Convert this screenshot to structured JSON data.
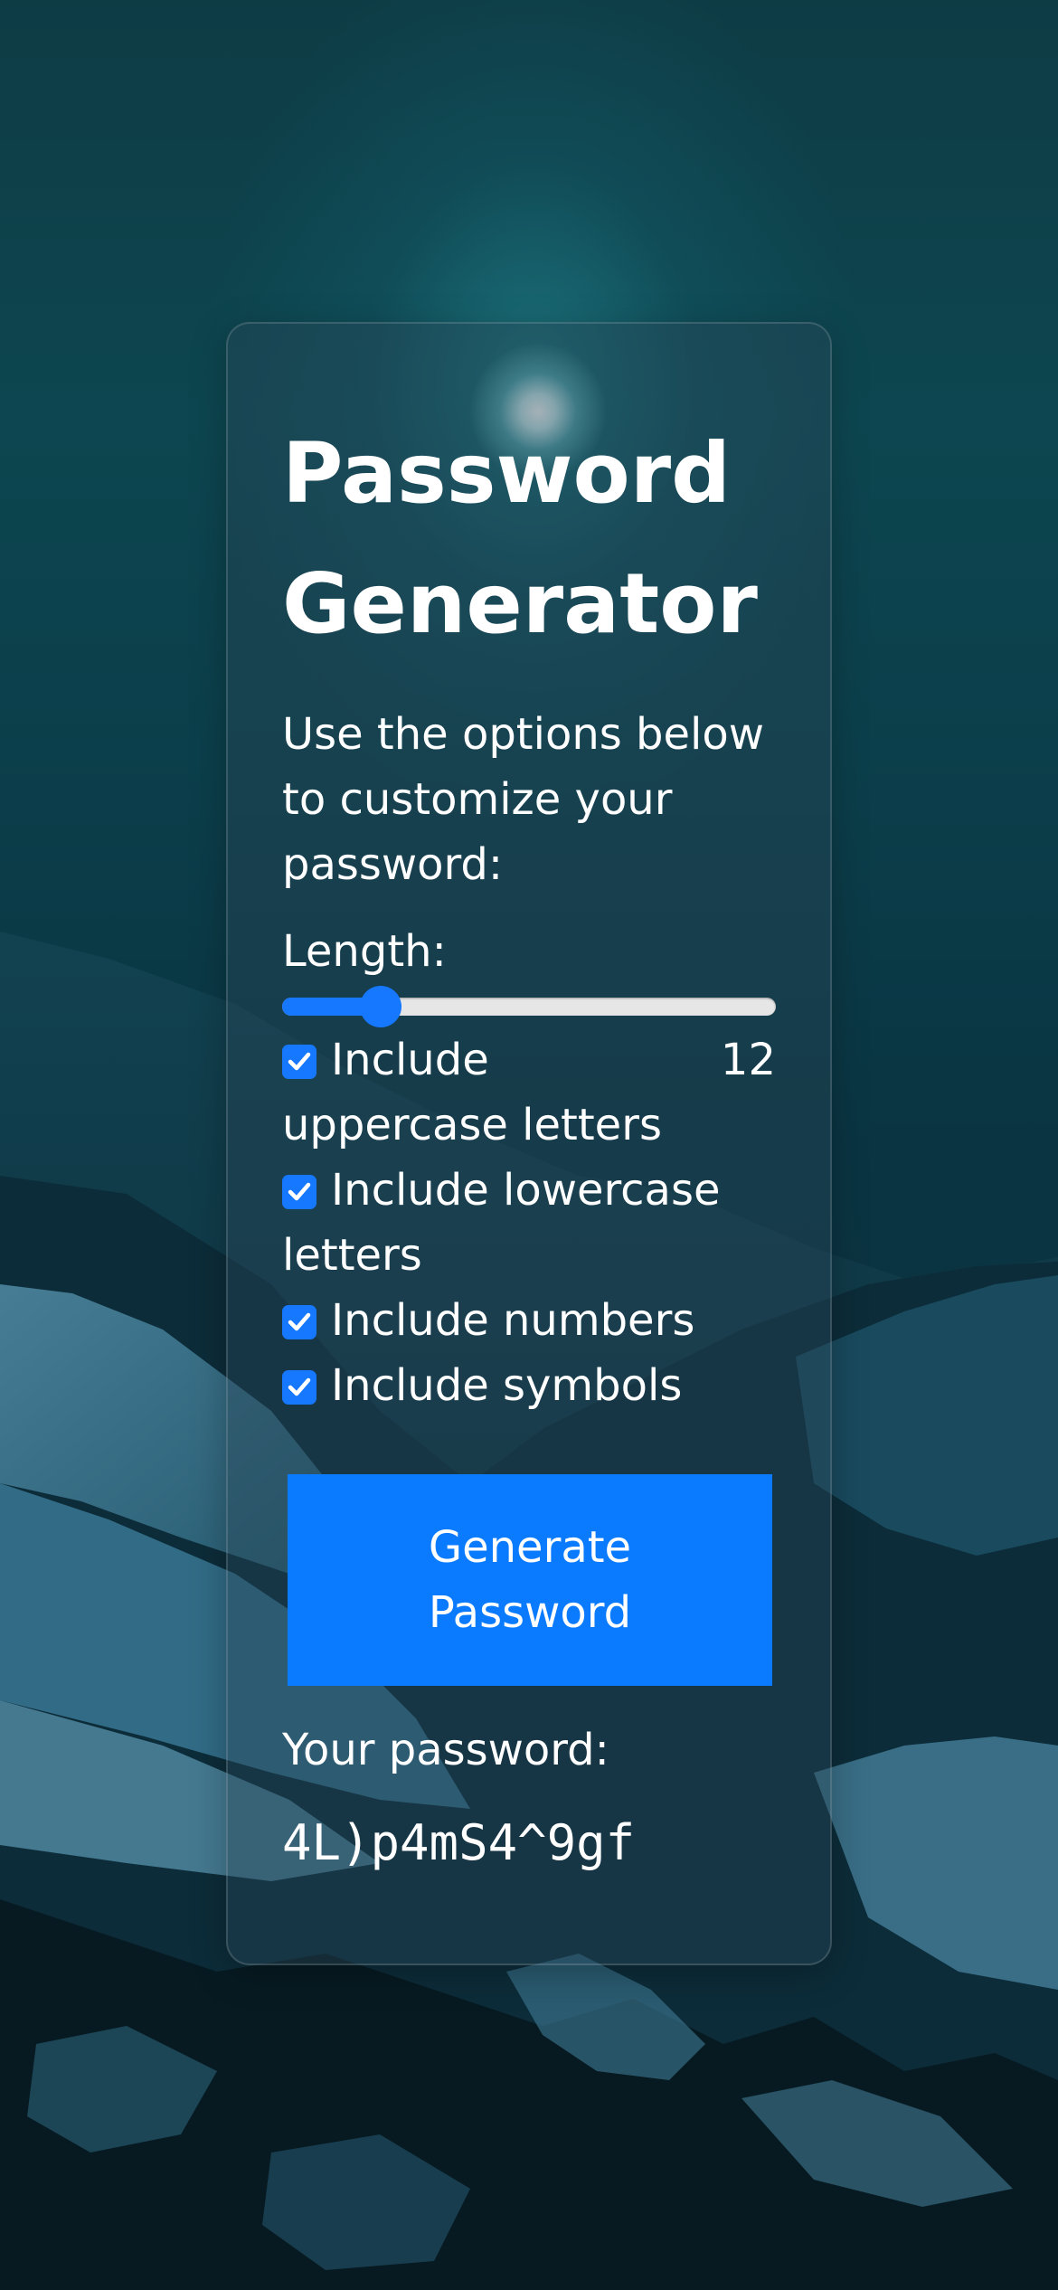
{
  "app": {
    "title": "Password Generator",
    "intro": "Use the options below to customize your password:"
  },
  "length": {
    "label": "Length:",
    "value": "12",
    "slider_fraction": 0.2
  },
  "options": [
    {
      "label": "Include uppercase letters",
      "checked": true
    },
    {
      "label": "Include lowercase letters",
      "checked": true
    },
    {
      "label": "Include numbers",
      "checked": true
    },
    {
      "label": "Include symbols",
      "checked": true
    }
  ],
  "generate_button_label": "Generate Password",
  "result": {
    "label": "Your password:",
    "password": "4L)p4mS4^9gf"
  },
  "colors": {
    "accent": "#0a7bff",
    "checkbox": "#1677ff"
  }
}
